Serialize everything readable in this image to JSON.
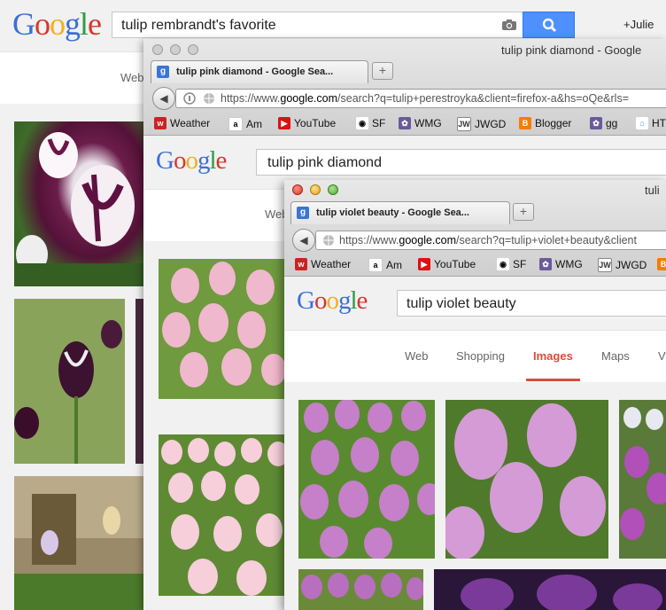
{
  "window1": {
    "logo": [
      "G",
      "o",
      "o",
      "g",
      "l",
      "e"
    ],
    "query": "tulip rembrandt's favorite",
    "user": "+Julie",
    "nav_partial": "Web"
  },
  "window2": {
    "title": "tulip pink diamond - Google",
    "tab_label": "tulip pink diamond - Google Sea...",
    "url_prefix": "https://www.",
    "url_domain": "google.com",
    "url_rest": "/search?q=tulip+perestroyka&client=firefox-a&hs=oQe&rls=",
    "bookmarks": [
      "Weather",
      "Am",
      "YouTube",
      "SF",
      "WMG",
      "JWGD",
      "Blogger",
      "gg",
      "HT"
    ],
    "logo": [
      "G",
      "o",
      "o",
      "g",
      "l",
      "e"
    ],
    "query": "tulip pink diamond",
    "nav_partial": "Web"
  },
  "window3": {
    "title": "tuli",
    "tab_label": "tulip violet beauty - Google Sea...",
    "url_prefix": "https://www.",
    "url_domain": "google.com",
    "url_rest": "/search?q=tulip+violet+beauty&client",
    "bookmarks": [
      "Weather",
      "Am",
      "YouTube",
      "SF",
      "WMG",
      "JWGD"
    ],
    "logo": [
      "G",
      "o",
      "o",
      "g",
      "l",
      "e"
    ],
    "query": "tulip violet beauty",
    "nav_tabs": [
      "Web",
      "Shopping",
      "Images",
      "Maps",
      "V"
    ],
    "active_tab": "Images"
  },
  "colors": {
    "google_blue": "#3b6fd6",
    "google_red": "#d6372c",
    "google_yellow": "#f2b01e",
    "google_green": "#2f9b47",
    "active_tab_red": "#dd4b39",
    "search_button": "#4d90fe"
  }
}
